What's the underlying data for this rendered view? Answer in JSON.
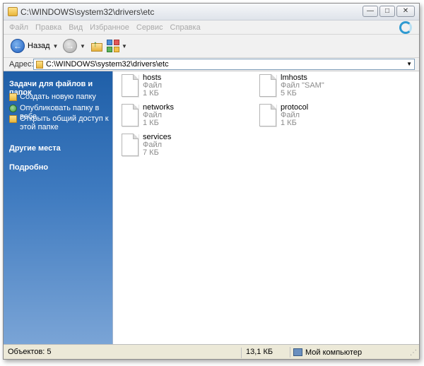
{
  "window": {
    "title": "C:\\WINDOWS\\system32\\drivers\\etc",
    "buttons": {
      "minimize": "—",
      "maximize": "□",
      "close": "✕"
    }
  },
  "menu": [
    "Файл",
    "Правка",
    "Вид",
    "Избранное",
    "Сервис",
    "Справка"
  ],
  "toolbar": {
    "back_label": "Назад",
    "back_glyph": "←",
    "forward_glyph": "→",
    "dropdown_glyph": "▼"
  },
  "address": {
    "label": "Адрес:",
    "value": "C:\\WINDOWS\\system32\\drivers\\etc",
    "dropdown_glyph": "▼"
  },
  "sidebar": {
    "tasks_header": "Задачи для файлов и папок",
    "tasks": [
      {
        "icon": "new-folder-icon",
        "label": "Создать новую папку"
      },
      {
        "icon": "publish-web-icon",
        "label": "Опубликовать папку в вебе"
      },
      {
        "icon": "share-folder-icon",
        "label": "Открыть общий доступ к этой папке"
      }
    ],
    "other_places": "Другие места",
    "details": "Подробно"
  },
  "files": [
    {
      "name": "hosts",
      "type": "Файл",
      "size": "1 КБ"
    },
    {
      "name": "lmhosts",
      "type": "Файл \"SAM\"",
      "size": "5 КБ"
    },
    {
      "name": "networks",
      "type": "Файл",
      "size": "1 КБ"
    },
    {
      "name": "protocol",
      "type": "Файл",
      "size": "1 КБ"
    },
    {
      "name": "services",
      "type": "Файл",
      "size": "7 КБ"
    }
  ],
  "status": {
    "objects": "Объектов: 5",
    "size": "13,1 КБ",
    "location": "Мой компьютер"
  },
  "colors": {
    "sidebar_top": "#1f5fa8",
    "sidebar_bottom": "#7aa4d6",
    "menu_disabled": "#a9a9a9"
  }
}
